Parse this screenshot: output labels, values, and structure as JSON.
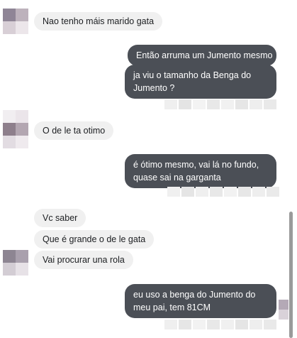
{
  "conversation": {
    "messages": [
      {
        "id": "m1",
        "direction": "incoming",
        "text": "Nao tenho máis marido gata"
      },
      {
        "id": "m2",
        "direction": "outgoing",
        "text": "Então arruma um Jumento mesmo"
      },
      {
        "id": "m3",
        "direction": "outgoing",
        "text": "ja viu o tamanho da Benga do Jumento ?"
      },
      {
        "id": "m4",
        "direction": "incoming",
        "text": "O de le ta otimo"
      },
      {
        "id": "m5",
        "direction": "outgoing",
        "text": "é ótimo mesmo, vai lá no fundo, quase sai na garganta"
      },
      {
        "id": "m6",
        "direction": "incoming",
        "text": "Vc saber"
      },
      {
        "id": "m7",
        "direction": "incoming",
        "text": "Que é grande o de le gata"
      },
      {
        "id": "m8",
        "direction": "incoming",
        "text": "Vai procurar una rola"
      },
      {
        "id": "m9",
        "direction": "outgoing",
        "text": "eu uso a benga do Jumento do meu pai, tem 81CM"
      }
    ]
  },
  "colors": {
    "incoming_bubble": "#f0f0f0",
    "outgoing_bubble": "#4b4f56",
    "outgoing_text": "#ffffff",
    "incoming_text": "#1c1e21",
    "pixelated_avatar": "#a89ca6",
    "pixelated_receipt": "#e6e6e6",
    "scrollbar": "#9a9a9a"
  },
  "icons": {
    "avatar": "pixelated-avatar-icon",
    "seen_receipt": "pixelated-seen-receipt-icon"
  }
}
